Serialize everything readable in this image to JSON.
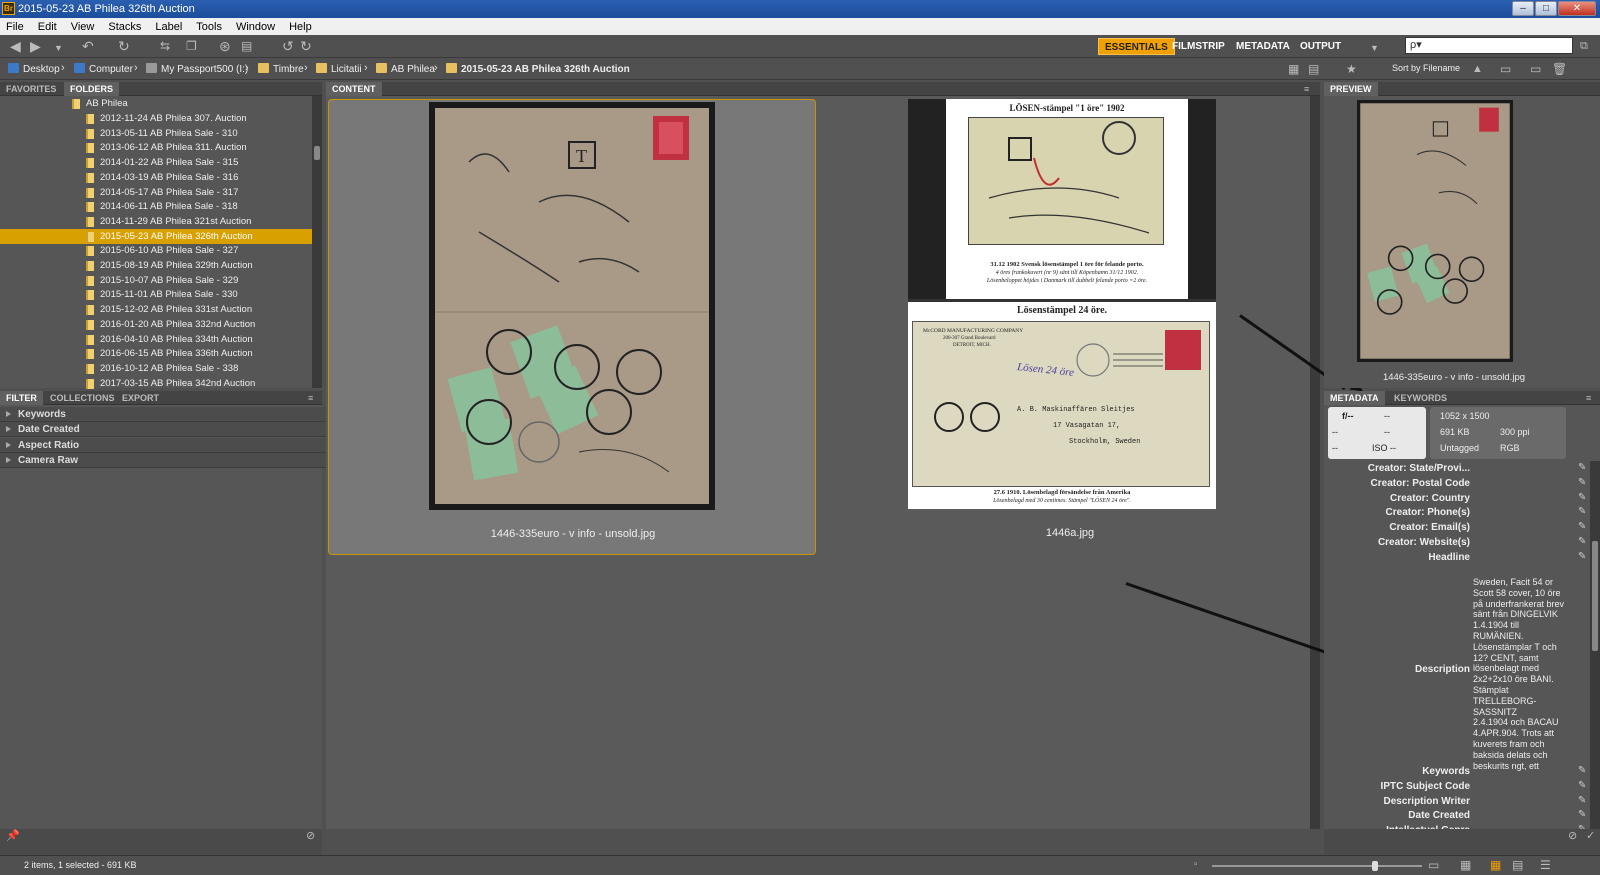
{
  "window": {
    "title": "2015-05-23 AB Philea 326th Auction",
    "app_icon": "Br"
  },
  "menu": [
    "File",
    "Edit",
    "View",
    "Stacks",
    "Label",
    "Tools",
    "Window",
    "Help"
  ],
  "workspaces": [
    "ESSENTIALS",
    "FILMSTRIP",
    "METADATA",
    "OUTPUT"
  ],
  "search": {
    "placeholder": "ρ▾"
  },
  "path": [
    "Desktop",
    "Computer",
    "My Passport500 (I:)",
    "Timbre",
    "Licitatii",
    "AB Philea",
    "2015-05-23 AB Philea 326th Auction"
  ],
  "sort_label": "Sort by Filename",
  "left_tabs": [
    "FAVORITES",
    "FOLDERS"
  ],
  "folder_root": "AB Philea",
  "folders": [
    "2012-11-24 AB Philea 307. Auction",
    "2013-05-11 AB Philea Sale - 310",
    "2013-06-12 AB Philea 311. Auction",
    "2014-01-22 AB Philea Sale - 315",
    "2014-03-19 AB Philea Sale - 316",
    "2014-05-17 AB Philea Sale - 317",
    "2014-06-11 AB Philea Sale - 318",
    "2014-11-29 AB Philea 321st Auction",
    "2015-05-23 AB Philea 326th Auction",
    "2015-06-10 AB Philea Sale - 327",
    "2015-08-19 AB Philea 329th Auction",
    "2015-10-07 AB Philea Sale - 329",
    "2015-11-01 AB Philea Sale - 330",
    "2015-12-02 AB Philea 331st Auction",
    "2016-01-20 AB Philea 332nd Auction",
    "2016-04-10 AB Philea 334th Auction",
    "2016-06-15 AB Philea 336th Auction",
    "2016-10-12 AB Philea Sale - 338",
    "2017-03-15 AB Philea 342nd Auction"
  ],
  "selected_folder_index": 8,
  "filter_tabs": [
    "FILTER",
    "COLLECTIONS",
    "EXPORT"
  ],
  "filter_items": [
    "Keywords",
    "Date Created",
    "Aspect Ratio",
    "Camera Raw"
  ],
  "content_tab": "CONTENT",
  "files": [
    {
      "name": "1446-335euro - v info - unsold.jpg",
      "selected": true
    },
    {
      "name": "1446a.jpg",
      "selected": false
    }
  ],
  "thumb2_text": {
    "top_title": "LÖSEN-stämpel \"1 öre\" 1902",
    "top_caption_bold": "31.12 1902  Svensk lösenstämpel 1 öre för felande porto.",
    "top_caption1": "4 öres frankokuvert (nr 9) sänt till Köpenhamn 31/12 1902.",
    "top_caption2": "Lösenbeloppet höjdes i Danmark till dubbelt felande porto =2 öre.",
    "bottom_title": "Lösenstämpel 24 öre.",
    "bottom_sender1": "McCORD MANUFACTURING COMPANY",
    "bottom_sender2": "200-307 Grand Boulevard",
    "bottom_sender3": "DETROIT, MICH.",
    "bottom_handwriting": "Lösen 24 öre",
    "addr1": "A. B. Maskinaffären Sleitjes",
    "addr2": "17 Vasagatan 17,",
    "addr3": "Stockholm, Sweden",
    "bottom_caption_bold": "27.6 1910.  Lösenbelagd försändelse från Amerika",
    "bottom_caption2": "Lösenbelagd med 30 centimes.  Stämpel \"LÖSEN 24 öre\"."
  },
  "preview_tab": "PREVIEW",
  "preview_caption": "1446-335euro - v info - unsold.jpg",
  "meta_tabs": [
    "METADATA",
    "KEYWORDS"
  ],
  "camera_info": {
    "fstop": "f/--",
    "shutter": "--",
    "c1": "--",
    "c2": "--",
    "c3": "--",
    "iso": "ISO --"
  },
  "file_info": {
    "dimensions": "1052 x 1500",
    "size": "691 KB",
    "ppi": "300 ppi",
    "tag": "Untagged",
    "mode": "RGB"
  },
  "metadata_fields": [
    "Creator: State/Provi...",
    "Creator: Postal Code",
    "Creator: Country",
    "Creator: Phone(s)",
    "Creator: Email(s)",
    "Creator: Website(s)",
    "Headline"
  ],
  "description_label": "Description",
  "description_lines": [
    "Sweden, Facit 54 or",
    "Scott 58 cover,  10 öre",
    "på underfrankerat brev",
    "sänt från DINGELVIK",
    "1.4.1904 till",
    "RUMÄNIEN.",
    "Lösenstämplar T och",
    "12? CENT, samt",
    "lösenbelagt med",
    "2x2+2x10 öre BANI.",
    "Stämplat",
    "TRELLEBORG-SASSNITZ",
    "2.4.1904 och BACAU",
    "4.APR.904. Trots att",
    "kuverets fram och",
    "baksida delats och",
    "beskurits ngt, ett"
  ],
  "metadata_fields_after": [
    "Keywords",
    "IPTC Subject Code",
    "Description Writer",
    "Date Created",
    "Intellectual Genre"
  ],
  "status": "2 items, 1 selected - 691 KB",
  "colors": {
    "accent": "#d8a000",
    "panel": "#565656",
    "chrome": "#505050"
  }
}
